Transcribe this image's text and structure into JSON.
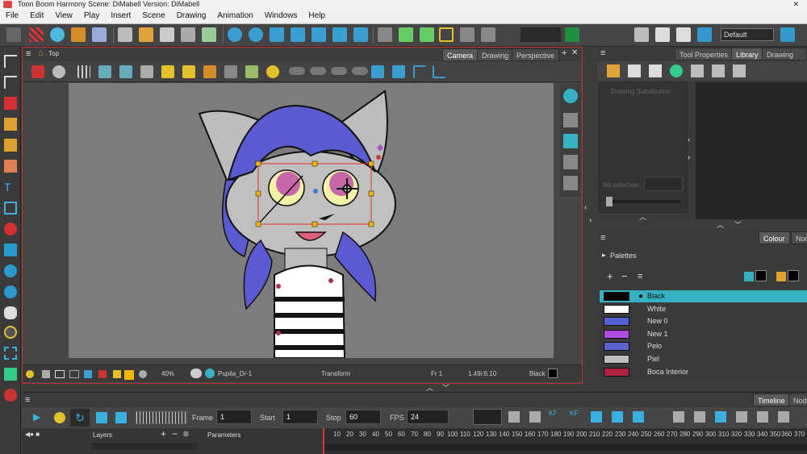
{
  "window": {
    "title": "Toon Boom Harmony Scene: DiMabell Version: DiMabell"
  },
  "menu": [
    "File",
    "Edit",
    "View",
    "Play",
    "Insert",
    "Scene",
    "Drawing",
    "Animation",
    "Windows",
    "Help"
  ],
  "toolbar": {
    "workspace": "Default"
  },
  "view": {
    "breadcrumb": "Top",
    "tabs": [
      "Camera",
      "Drawing",
      "Perspective"
    ],
    "active_tab": "Camera"
  },
  "status": {
    "zoom": "40%",
    "drawing": "Pupila_Dr-1",
    "mode": "Transform",
    "frame": "Fr 1",
    "coords": "1.49i:6.10",
    "colour": "Black"
  },
  "right_panel": {
    "tabs": [
      "Tool Properties",
      "Library",
      "Drawing Subs"
    ],
    "active_tab": "Library",
    "library_faded_1": "Drawing Substitution",
    "library_faded_2": "No selection"
  },
  "colour_panel": {
    "tabs": [
      "Colour",
      "Node"
    ],
    "active_tab": "Colour",
    "palettes_label": "Palettes",
    "swatches": [
      {
        "name": "Black",
        "color": "#000000"
      },
      {
        "name": "White",
        "color": "#ffffff"
      },
      {
        "name": "New 0",
        "color": "#5860d8"
      },
      {
        "name": "New 1",
        "color": "#b04ae0"
      },
      {
        "name": "Pelo",
        "color": "#5a62d0"
      },
      {
        "name": "Piel",
        "color": "#bdbdbd"
      },
      {
        "name": "Boca Interior",
        "color": "#b02040"
      }
    ],
    "selected": "Black"
  },
  "timeline": {
    "tabs": [
      "Timeline",
      "Node"
    ],
    "active_tab": "Timeline",
    "frame_label": "Frame",
    "frame": "1",
    "start_label": "Start",
    "start": "1",
    "stop_label": "Stop",
    "stop": "60",
    "fps_label": "FPS",
    "fps": "24",
    "layers_label": "Layers",
    "parameters_label": "Parameters",
    "ruler": [
      "10",
      "20",
      "30",
      "40",
      "50",
      "60",
      "70",
      "80",
      "90",
      "100",
      "110",
      "120",
      "130",
      "140",
      "150",
      "160",
      "170",
      "180",
      "190",
      "200",
      "210",
      "220",
      "230",
      "240",
      "250",
      "260",
      "270",
      "280",
      "290",
      "300",
      "310",
      "320",
      "330",
      "340",
      "350",
      "360",
      "370"
    ]
  },
  "colors": {
    "accent": "#35b1c2",
    "selection_red": "#d33",
    "hair": "#5a5ad2",
    "skin": "#c0c0c0"
  }
}
